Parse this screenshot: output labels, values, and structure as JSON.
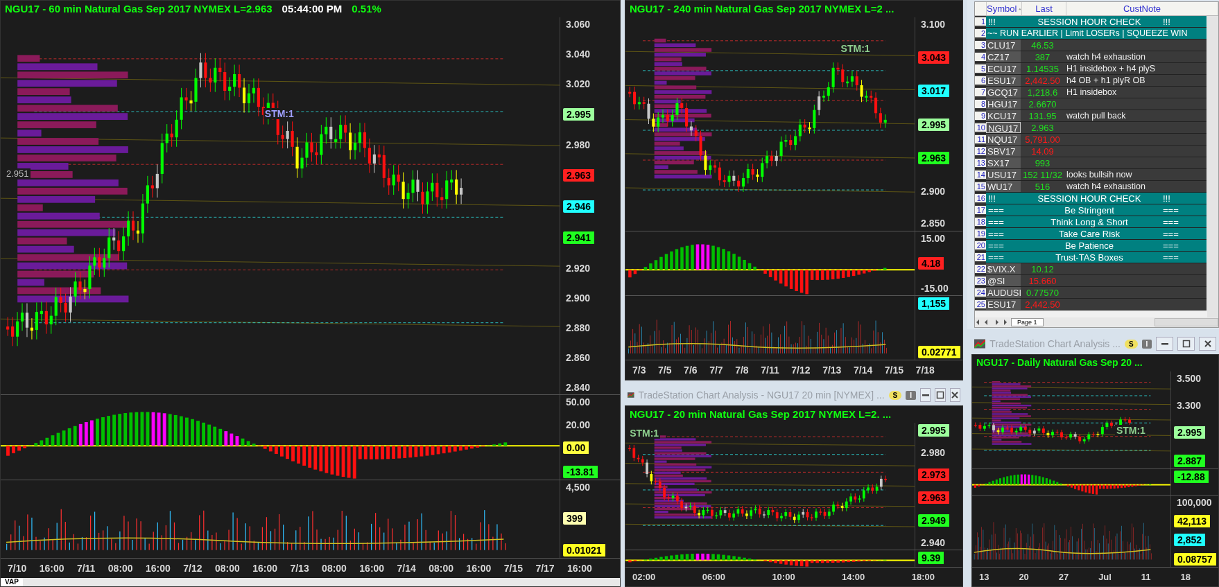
{
  "charts": [
    {
      "kind": "main",
      "title": [
        {
          "text": "NGU17 - 60 min  Natural Gas Sep 2017  NYMEX  L=2.963",
          "white": false
        },
        {
          "text": "05:44:00 PM",
          "white": true
        },
        {
          "text": "0.51%",
          "white": false
        }
      ],
      "marker": "STM:1",
      "level_label": "2.951",
      "panes": [
        {
          "kind": "price",
          "axis": [
            {
              "text": "3.060"
            },
            {
              "text": "3.040"
            },
            {
              "text": "3.020"
            },
            {
              "text": "2.995",
              "color": "#9cff9c"
            },
            {
              "text": "2.980"
            },
            {
              "text": "2.963",
              "color": "#ff2020"
            },
            {
              "text": "2.946",
              "color": "#20ffff"
            },
            {
              "text": "2.941",
              "color": "#20ff20"
            },
            {
              "text": "2.920"
            },
            {
              "text": "2.900"
            },
            {
              "text": "2.880"
            },
            {
              "text": "2.860"
            },
            {
              "text": "2.840"
            }
          ]
        },
        {
          "kind": "oscillator",
          "axis": [
            {
              "text": "50.00"
            },
            {
              "text": "20.00"
            },
            {
              "text": "0.00",
              "color": "#ffff40"
            },
            {
              "text": "-13.81",
              "color": "#20ff20"
            }
          ]
        },
        {
          "kind": "volume",
          "axis": [
            {
              "text": "4,500"
            },
            {
              "text": "399",
              "color": "#ffffb0"
            },
            {
              "text": "0.01021",
              "color": "#ffff20"
            }
          ]
        }
      ],
      "x_labels": [
        "7/10",
        "16:00",
        "7/11",
        "08:00",
        "16:00",
        "7/12",
        "08:00",
        "16:00",
        "7/13",
        "08:00",
        "16:00",
        "7/14",
        "08:00",
        "16:00",
        "7/15",
        "7/17",
        "16:00"
      ],
      "bottom_tabs": [
        "VAP"
      ]
    },
    {
      "kind": "h4",
      "title": [
        {
          "text": "NGU17 - 240 min  Natural Gas Sep 2017  NYMEX  L=2 ...",
          "white": false
        }
      ],
      "marker": "STM:1",
      "panes": [
        {
          "kind": "price",
          "axis": [
            {
              "text": "3.100"
            },
            {
              "text": "3.043",
              "color": "#ff2020"
            },
            {
              "text": "3.017",
              "color": "#20ffff"
            },
            {
              "text": "2.995",
              "color": "#9cff9c"
            },
            {
              "text": "2.963",
              "color": "#20ff20"
            },
            {
              "text": "2.900"
            },
            {
              "text": "2.850"
            }
          ]
        },
        {
          "kind": "oscillator",
          "axis": [
            {
              "text": "15.00"
            },
            {
              "text": "4.18",
              "color": "#ff2020"
            },
            {
              "text": "-15.00"
            }
          ]
        },
        {
          "kind": "volume",
          "axis": [
            {
              "text": "1,155",
              "color": "#20ffff"
            },
            {
              "text": "0.02771",
              "color": "#ffff20"
            }
          ]
        }
      ],
      "x_labels": [
        "7/3",
        "7/5",
        "7/6",
        "7/7",
        "7/8",
        "7/11",
        "7/12",
        "7/13",
        "7/14",
        "7/15",
        "7/18"
      ]
    },
    {
      "kind": "m20",
      "window_title": "TradeStation Chart Analysis - NGU17 20 min [NYMEX] ...",
      "badges": [
        "S",
        "I"
      ],
      "title": [
        {
          "text": "NGU17 - 20 min  Natural Gas Sep 2017  NYMEX  L=2. ...",
          "white": false
        }
      ],
      "marker": "STM:1",
      "panes": [
        {
          "kind": "price",
          "axis": [
            {
              "text": "2.995",
              "color": "#9cff9c"
            },
            {
              "text": "2.980"
            },
            {
              "text": "2.973",
              "color": "#ff2020"
            },
            {
              "text": "2.963",
              "color": "#ff2020"
            },
            {
              "text": "2.949",
              "color": "#20ff20"
            },
            {
              "text": "2.940"
            }
          ]
        },
        {
          "kind": "oscillator",
          "axis": [
            {
              "text": "9.39",
              "color": "#20ff20"
            }
          ]
        }
      ],
      "x_labels": [
        "02:00",
        "06:00",
        "10:00",
        "14:00",
        "18:00"
      ]
    },
    {
      "kind": "daily",
      "window_title": "TradeStation Chart Analysis ...",
      "badges": [
        "S",
        "I"
      ],
      "title": [
        {
          "text": "NGU17 - Daily  Natural Gas Sep 20 ...",
          "white": false
        }
      ],
      "marker": "STM:1",
      "panes": [
        {
          "kind": "price",
          "axis": [
            {
              "text": "3.500"
            },
            {
              "text": "3.300"
            },
            {
              "text": "2.995",
              "color": "#9cff9c"
            },
            {
              "text": "2.887",
              "color": "#20ff20"
            }
          ]
        },
        {
          "kind": "oscillator",
          "axis": [
            {
              "text": "-12.88",
              "color": "#20ff20"
            }
          ]
        },
        {
          "kind": "volume",
          "axis": [
            {
              "text": "100,000"
            },
            {
              "text": "42,113",
              "color": "#ffff20"
            },
            {
              "text": "2,852",
              "color": "#20ffff"
            },
            {
              "text": "0.08757",
              "color": "#ffff20"
            }
          ]
        }
      ],
      "x_labels": [
        "13",
        "20",
        "27",
        "Jul",
        "11",
        "18"
      ]
    }
  ],
  "watchlist": {
    "columns": [
      "Symbol",
      "Last",
      "CustNote"
    ],
    "sheet_tab": "Page 1",
    "rows": [
      {
        "num": "1",
        "kind": "banner",
        "left": "!!!",
        "center": "SESSION HOUR CHECK",
        "right": "!!!"
      },
      {
        "num": "2",
        "kind": "note",
        "text": "~~ RUN EARLIER | Limit LOSERs | SQUEEZE WIN"
      },
      {
        "num": "3",
        "kind": "quote",
        "symbol": "CLU17",
        "last": "46.53",
        "down": false,
        "selected": false
      },
      {
        "num": "4",
        "kind": "quote",
        "symbol": "CZ17",
        "last": "387",
        "down": false,
        "note": "watch h4 exhaustion",
        "selected": false
      },
      {
        "num": "5",
        "kind": "quote",
        "symbol": "ECU17",
        "last": "1.14535",
        "down": false,
        "note": "H1 insidebox + h4 plyS",
        "selected": false
      },
      {
        "num": "6",
        "kind": "quote",
        "symbol": "ESU17",
        "last": "2,442.50",
        "down": true,
        "note": "h4 OB + h1 plyR OB",
        "selected": false
      },
      {
        "num": "7",
        "kind": "quote",
        "symbol": "GCQ17",
        "last": "1,218.6",
        "down": false,
        "note": "H1 insidebox",
        "selected": false
      },
      {
        "num": "8",
        "kind": "quote",
        "symbol": "HGU17",
        "last": "2.6670",
        "down": false,
        "selected": false
      },
      {
        "num": "9",
        "kind": "quote",
        "symbol": "KCU17",
        "last": "131.95",
        "down": false,
        "note": "watch pull back",
        "selected": false
      },
      {
        "num": "10",
        "kind": "quote",
        "symbol": "NGU17",
        "last": "2.963",
        "down": false,
        "selected": true
      },
      {
        "num": "11",
        "kind": "quote",
        "symbol": "NQU17",
        "last": "5,791.00",
        "down": true,
        "selected": false
      },
      {
        "num": "12",
        "kind": "quote",
        "symbol": "SBV17",
        "last": "14.09",
        "down": true,
        "selected": false
      },
      {
        "num": "13",
        "kind": "quote",
        "symbol": "SX17",
        "last": "993",
        "down": false,
        "selected": false
      },
      {
        "num": "14",
        "kind": "quote",
        "symbol": "USU17",
        "last": "152  11/32",
        "down": false,
        "note": "looks bullsih now",
        "selected": false
      },
      {
        "num": "15",
        "kind": "quote",
        "symbol": "WU17",
        "last": "516",
        "down": false,
        "note": "watch h4 exhaustion",
        "selected": false
      },
      {
        "num": "16",
        "kind": "banner",
        "left": "!!!",
        "center": "SESSION HOUR CHECK",
        "right": "!!!"
      },
      {
        "num": "17",
        "kind": "banner",
        "left": "===",
        "center": "Be Stringent",
        "right": "==="
      },
      {
        "num": "18",
        "kind": "banner",
        "left": "===",
        "center": "Think Long & Short",
        "right": "==="
      },
      {
        "num": "19",
        "kind": "banner",
        "left": "===",
        "center": "Take Care Risk",
        "right": "==="
      },
      {
        "num": "20",
        "kind": "banner",
        "left": "===",
        "center": "Be  Patience",
        "right": "==="
      },
      {
        "num": "21",
        "kind": "banner",
        "left": "===",
        "center": "Trust-TAS Boxes",
        "right": "==="
      },
      {
        "num": "22",
        "kind": "quote",
        "symbol": "$VIX.X",
        "last": "10.12",
        "down": false,
        "selected": false
      },
      {
        "num": "23",
        "kind": "quote",
        "symbol": "@SI",
        "last": "15.660",
        "down": true,
        "selected": false
      },
      {
        "num": "24",
        "kind": "quote",
        "symbol": "AUDUSI",
        "last": "0.77570",
        "down": false,
        "selected": false
      },
      {
        "num": "25",
        "kind": "quote",
        "symbol": "ESU17",
        "last": "2,442.50",
        "down": true,
        "selected": false
      }
    ]
  }
}
